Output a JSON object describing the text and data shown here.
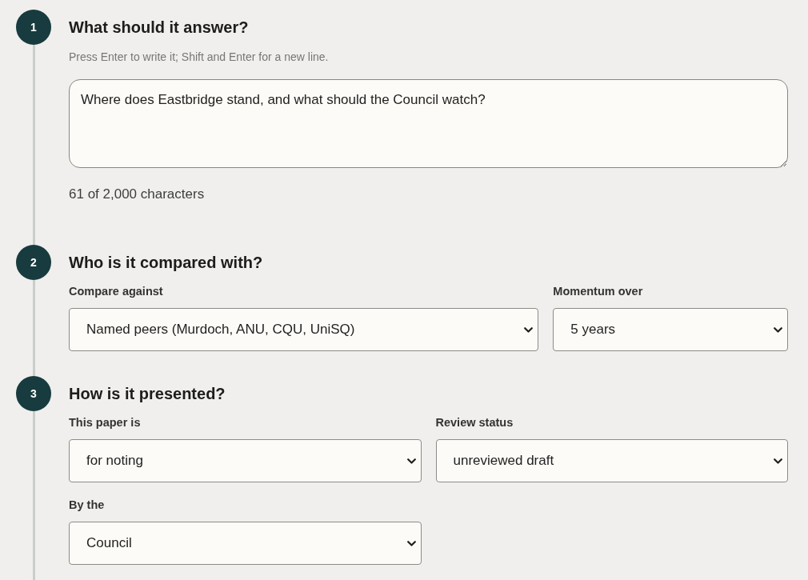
{
  "steps": [
    {
      "kind": "text",
      "number": "1",
      "title": "What should it answer?",
      "hint": "Press Enter to write it; Shift and Enter for a new line.",
      "question": {
        "value": "Where does Eastbridge stand, and what should the Council watch?"
      },
      "counter": "61 of 2,000 characters"
    },
    {
      "kind": "choices",
      "number": "2",
      "title": "Who is it compared with?",
      "fields": [
        {
          "label": "Compare against",
          "value": "Named peers (Murdoch, ANU, CQU, UniSQ)"
        },
        {
          "label": "Momentum over",
          "value": "5 years"
        }
      ]
    },
    {
      "kind": "choices",
      "number": "3",
      "title": "How is it presented?",
      "fields": [
        {
          "label": "This paper is",
          "value": "for noting"
        },
        {
          "label": "Review status",
          "value": "unreviewed draft"
        },
        {
          "label": "By the",
          "value": "Council"
        }
      ]
    }
  ]
}
